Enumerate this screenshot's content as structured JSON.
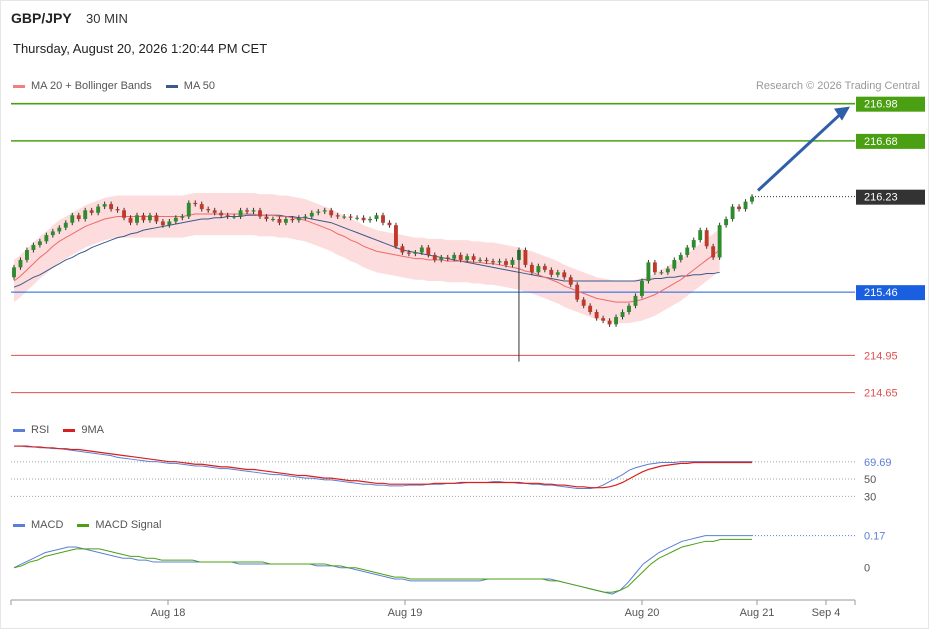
{
  "header": {
    "pair": "GBP/JPY",
    "timeframe": "30 MIN",
    "datetime": "Thursday, August 20, 2026 1:20:44 PM CET"
  },
  "legend_main": [
    {
      "label": "MA 20 + Bollinger Bands",
      "color": "#f08080"
    },
    {
      "label": "MA 50",
      "color": "#3a5a8c"
    }
  ],
  "research": "Research © 2026 Trading Central",
  "legend_rsi": [
    {
      "label": "RSI",
      "color": "#5b7fd6"
    },
    {
      "label": "9MA",
      "color": "#d81e1e"
    }
  ],
  "legend_macd": [
    {
      "label": "MACD",
      "color": "#5b7fd6"
    },
    {
      "label": "MACD Signal",
      "color": "#4aa012"
    }
  ],
  "chart_data": {
    "type": "candlestick",
    "price_range": [
      214.55,
      217.05
    ],
    "levels": [
      {
        "label": "216.98",
        "value": 216.98,
        "kind": "target",
        "color": "#4aa012"
      },
      {
        "label": "216.68",
        "value": 216.68,
        "kind": "target",
        "color": "#4aa012"
      },
      {
        "label": "216.23",
        "value": 216.23,
        "kind": "last",
        "color": "#333333"
      },
      {
        "label": "215.46",
        "value": 215.46,
        "kind": "pivot",
        "color": "#1a5fe0"
      },
      {
        "label": "214.95",
        "value": 214.95,
        "kind": "support",
        "color": "#e05050"
      },
      {
        "label": "214.65",
        "value": 214.65,
        "kind": "support",
        "color": "#e05050"
      }
    ],
    "x_labels": [
      "Aug 18",
      "Aug 19",
      "Aug 20",
      "Aug 21",
      "Sep 4"
    ],
    "close": [
      215.66,
      215.72,
      215.8,
      215.84,
      215.87,
      215.92,
      215.95,
      215.98,
      216.02,
      216.08,
      216.05,
      216.12,
      216.1,
      216.15,
      216.17,
      216.13,
      216.12,
      216.06,
      216.02,
      216.08,
      216.04,
      216.08,
      216.03,
      216.0,
      216.03,
      216.06,
      216.07,
      216.18,
      216.17,
      216.13,
      216.12,
      216.1,
      216.08,
      216.07,
      216.07,
      216.12,
      216.11,
      216.12,
      216.07,
      216.05,
      216.05,
      216.02,
      216.05,
      216.04,
      216.06,
      216.07,
      216.1,
      216.11,
      216.12,
      216.08,
      216.07,
      216.07,
      216.06,
      216.06,
      216.04,
      216.05,
      216.08,
      216.02,
      216.0,
      215.83,
      215.78,
      215.77,
      215.78,
      215.82,
      215.76,
      215.72,
      215.74,
      215.73,
      215.76,
      215.72,
      215.75,
      215.72,
      215.72,
      215.71,
      215.7,
      215.71,
      215.68,
      215.72,
      215.8,
      215.68,
      215.62,
      215.67,
      215.64,
      215.6,
      215.62,
      215.58,
      215.52,
      215.4,
      215.35,
      215.3,
      215.25,
      215.23,
      215.2,
      215.26,
      215.3,
      215.35,
      215.43,
      215.55,
      215.7,
      215.62,
      215.62,
      215.65,
      215.72,
      215.76,
      215.82,
      215.88,
      215.96,
      215.83,
      215.74,
      216.0,
      216.05,
      216.15,
      216.13,
      216.19,
      216.23
    ],
    "open": [
      215.58,
      215.66,
      215.72,
      215.8,
      215.84,
      215.87,
      215.92,
      215.95,
      215.98,
      216.02,
      216.08,
      216.05,
      216.12,
      216.1,
      216.15,
      216.17,
      216.13,
      216.12,
      216.06,
      216.02,
      216.08,
      216.04,
      216.08,
      216.03,
      216.0,
      216.03,
      216.06,
      216.07,
      216.18,
      216.17,
      216.13,
      216.12,
      216.1,
      216.08,
      216.07,
      216.07,
      216.12,
      216.11,
      216.12,
      216.07,
      216.05,
      216.05,
      216.02,
      216.05,
      216.04,
      216.06,
      216.07,
      216.1,
      216.11,
      216.12,
      216.08,
      216.07,
      216.07,
      216.06,
      216.06,
      216.04,
      216.05,
      216.08,
      216.02,
      216.0,
      215.83,
      215.78,
      215.77,
      215.78,
      215.82,
      215.76,
      215.72,
      215.74,
      215.73,
      215.76,
      215.72,
      215.75,
      215.72,
      215.72,
      215.71,
      215.7,
      215.71,
      215.68,
      215.72,
      215.8,
      215.68,
      215.62,
      215.67,
      215.64,
      215.6,
      215.62,
      215.58,
      215.52,
      215.4,
      215.35,
      215.3,
      215.25,
      215.23,
      215.2,
      215.26,
      215.3,
      215.35,
      215.43,
      215.55,
      215.7,
      215.62,
      215.62,
      215.65,
      215.72,
      215.76,
      215.82,
      215.88,
      215.96,
      215.83,
      215.74,
      216.0,
      216.05,
      216.15,
      216.13,
      216.19
    ],
    "ma20": [
      215.55,
      215.59,
      215.64,
      215.69,
      215.74,
      215.78,
      215.83,
      215.87,
      215.9,
      215.93,
      215.96,
      215.99,
      216.01,
      216.03,
      216.05,
      216.06,
      216.07,
      216.07,
      216.07,
      216.07,
      216.07,
      216.07,
      216.07,
      216.07,
      216.07,
      216.07,
      216.07,
      216.08,
      216.09,
      216.09,
      216.09,
      216.09,
      216.09,
      216.09,
      216.09,
      216.09,
      216.09,
      216.09,
      216.08,
      216.08,
      216.08,
      216.07,
      216.07,
      216.06,
      216.05,
      216.04,
      216.02,
      216.0,
      215.98,
      215.96,
      215.93,
      215.91,
      215.88,
      215.86,
      215.83,
      215.81,
      215.79,
      215.78,
      215.77,
      215.76,
      215.75,
      215.74,
      215.73,
      215.73,
      215.72,
      215.72,
      215.72,
      215.71,
      215.71,
      215.71,
      215.71,
      215.7,
      215.7,
      215.69,
      215.69,
      215.68,
      215.67,
      215.66,
      215.65,
      215.63,
      215.62,
      215.6,
      215.58,
      215.56,
      215.54,
      215.51,
      215.49,
      215.47,
      215.45,
      215.43,
      215.41,
      215.4,
      215.39,
      215.38,
      215.38,
      215.38,
      215.39,
      215.4,
      215.42,
      215.44,
      215.47,
      215.5,
      215.53,
      215.56,
      215.6,
      215.64,
      215.68,
      215.72,
      215.76,
      215.8
    ],
    "ma50": [
      215.5,
      215.52,
      215.55,
      215.58,
      215.6,
      215.63,
      215.66,
      215.69,
      215.72,
      215.74,
      215.77,
      215.79,
      215.82,
      215.84,
      215.86,
      215.88,
      215.9,
      215.91,
      215.93,
      215.94,
      215.96,
      215.97,
      215.98,
      215.99,
      216.0,
      216.01,
      216.02,
      216.03,
      216.04,
      216.05,
      216.05,
      216.06,
      216.06,
      216.07,
      216.07,
      216.07,
      216.08,
      216.08,
      216.08,
      216.08,
      216.08,
      216.08,
      216.07,
      216.07,
      216.06,
      216.06,
      216.05,
      216.04,
      216.03,
      216.02,
      216.0,
      215.98,
      215.96,
      215.94,
      215.92,
      215.9,
      215.88,
      215.86,
      215.84,
      215.82,
      215.8,
      215.79,
      215.78,
      215.77,
      215.76,
      215.75,
      215.74,
      215.73,
      215.72,
      215.71,
      215.7,
      215.69,
      215.68,
      215.67,
      215.66,
      215.65,
      215.64,
      215.63,
      215.62,
      215.61,
      215.6,
      215.59,
      215.58,
      215.57,
      215.56,
      215.55,
      215.55,
      215.55,
      215.55,
      215.55,
      215.55,
      215.55,
      215.55,
      215.55,
      215.55,
      215.55,
      215.55,
      215.56,
      215.56,
      215.57,
      215.57,
      215.58,
      215.58,
      215.59,
      215.59,
      215.6,
      215.6,
      215.61,
      215.61,
      215.62
    ],
    "rsi": {
      "series": [
        "RSI",
        "9MA"
      ],
      "levels": [
        69.69,
        50,
        30
      ],
      "level_labels": [
        "69.69",
        "50",
        "30"
      ],
      "rsi_values": [
        88,
        88,
        87,
        87,
        86,
        86,
        85,
        85,
        84,
        83,
        82,
        81,
        80,
        79,
        78,
        77,
        75,
        74,
        73,
        72,
        71,
        70,
        70,
        69,
        68,
        68,
        67,
        66,
        65,
        65,
        64,
        63,
        62,
        62,
        61,
        60,
        59,
        58,
        57,
        56,
        55,
        55,
        54,
        53,
        52,
        51,
        51,
        50,
        49,
        49,
        48,
        47,
        46,
        45,
        44,
        44,
        43,
        43,
        42,
        42,
        42,
        43,
        43,
        43,
        44,
        44,
        44,
        45,
        45,
        45,
        46,
        46,
        46,
        46,
        47,
        47,
        46,
        46,
        45,
        45,
        44,
        44,
        43,
        43,
        42,
        41,
        40,
        39,
        39,
        39,
        40,
        43,
        47,
        51,
        55,
        60,
        63,
        65,
        67,
        68,
        69,
        69,
        69,
        70,
        70,
        70,
        70,
        70,
        70,
        70,
        70,
        70,
        70,
        70,
        70
      ],
      "ma_values": [
        88,
        88,
        88,
        87,
        87,
        86,
        86,
        85,
        85,
        84,
        84,
        83,
        82,
        81,
        80,
        79,
        78,
        77,
        76,
        75,
        74,
        73,
        72,
        71,
        70,
        70,
        69,
        68,
        67,
        67,
        66,
        65,
        64,
        64,
        63,
        62,
        61,
        61,
        60,
        59,
        58,
        57,
        56,
        55,
        54,
        54,
        53,
        52,
        51,
        51,
        50,
        49,
        48,
        48,
        47,
        46,
        45,
        45,
        44,
        44,
        44,
        44,
        44,
        44,
        44,
        45,
        45,
        45,
        45,
        46,
        46,
        46,
        46,
        46,
        46,
        46,
        46,
        46,
        46,
        45,
        45,
        45,
        44,
        44,
        43,
        43,
        42,
        41,
        41,
        40,
        40,
        40,
        41,
        43,
        46,
        50,
        54,
        58,
        61,
        63,
        65,
        66,
        67,
        68,
        68,
        69,
        69,
        69,
        69,
        69,
        69,
        69,
        69,
        69,
        69
      ]
    },
    "macd": {
      "series": [
        "MACD",
        "MACD Signal"
      ],
      "levels": [
        0.17,
        0
      ],
      "level_labels": [
        "0.17",
        "0"
      ],
      "macd_values": [
        0.0,
        0.02,
        0.04,
        0.06,
        0.08,
        0.09,
        0.1,
        0.11,
        0.11,
        0.1,
        0.09,
        0.08,
        0.07,
        0.06,
        0.05,
        0.05,
        0.04,
        0.04,
        0.03,
        0.03,
        0.03,
        0.03,
        0.03,
        0.03,
        0.03,
        0.03,
        0.03,
        0.03,
        0.03,
        0.02,
        0.02,
        0.02,
        0.02,
        0.02,
        0.02,
        0.02,
        0.02,
        0.02,
        0.02,
        0.01,
        0.01,
        0.01,
        0.0,
        0.0,
        -0.01,
        -0.02,
        -0.03,
        -0.04,
        -0.05,
        -0.06,
        -0.06,
        -0.07,
        -0.07,
        -0.07,
        -0.07,
        -0.07,
        -0.07,
        -0.07,
        -0.07,
        -0.07,
        -0.07,
        -0.06,
        -0.06,
        -0.06,
        -0.06,
        -0.06,
        -0.06,
        -0.06,
        -0.06,
        -0.06,
        -0.07,
        -0.08,
        -0.09,
        -0.1,
        -0.11,
        -0.12,
        -0.13,
        -0.14,
        -0.12,
        -0.08,
        -0.03,
        0.02,
        0.05,
        0.08,
        0.1,
        0.12,
        0.14,
        0.15,
        0.16,
        0.17,
        0.17,
        0.17,
        0.17,
        0.17,
        0.17,
        0.17
      ],
      "signal_values": [
        0.0,
        0.01,
        0.03,
        0.04,
        0.06,
        0.07,
        0.08,
        0.09,
        0.1,
        0.1,
        0.1,
        0.1,
        0.09,
        0.08,
        0.07,
        0.06,
        0.06,
        0.05,
        0.05,
        0.04,
        0.04,
        0.04,
        0.04,
        0.04,
        0.03,
        0.03,
        0.03,
        0.03,
        0.03,
        0.03,
        0.03,
        0.03,
        0.03,
        0.02,
        0.02,
        0.02,
        0.02,
        0.02,
        0.02,
        0.02,
        0.02,
        0.01,
        0.01,
        0.0,
        0.0,
        -0.01,
        -0.02,
        -0.03,
        -0.04,
        -0.05,
        -0.05,
        -0.06,
        -0.06,
        -0.06,
        -0.06,
        -0.06,
        -0.06,
        -0.06,
        -0.06,
        -0.06,
        -0.06,
        -0.06,
        -0.06,
        -0.06,
        -0.06,
        -0.06,
        -0.06,
        -0.06,
        -0.06,
        -0.07,
        -0.07,
        -0.08,
        -0.09,
        -0.1,
        -0.11,
        -0.12,
        -0.13,
        -0.13,
        -0.12,
        -0.1,
        -0.06,
        -0.02,
        0.02,
        0.05,
        0.07,
        0.09,
        0.11,
        0.12,
        0.13,
        0.14,
        0.14,
        0.15,
        0.15,
        0.15,
        0.15,
        0.15
      ]
    }
  }
}
